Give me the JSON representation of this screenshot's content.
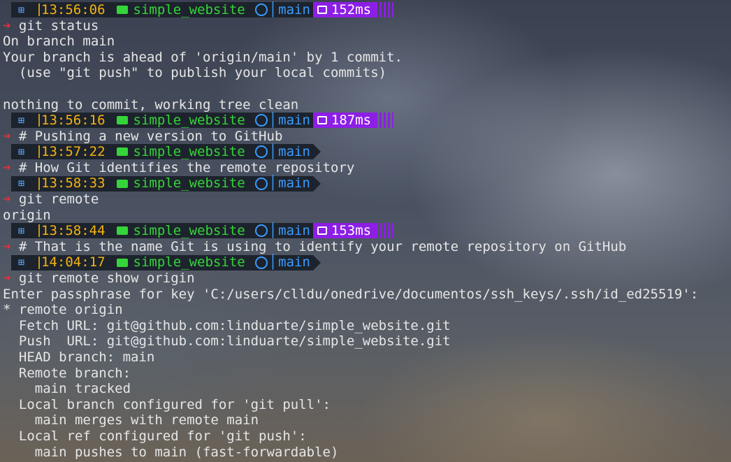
{
  "colors": {
    "prompt_bg": "#1d232c",
    "time": "#f5b313",
    "dir": "#35d43a",
    "git": "#3b9bff",
    "duration_bg": "#8d1ee6",
    "arrow": "#e0303a",
    "text": "#e6e6e6"
  },
  "icons": {
    "os": "windows-icon",
    "dir": "folder-icon",
    "git": "github-icon",
    "branch": "branch-icon",
    "duration": "stopwatch-icon",
    "prompt_arrow": "➜"
  },
  "lines": [
    {
      "type": "prompt",
      "time": "13:56:06",
      "dir": "simple_website",
      "branch": "main",
      "duration": "152ms"
    },
    {
      "type": "cmd",
      "text": "git status"
    },
    {
      "type": "out",
      "text": "On branch main"
    },
    {
      "type": "out",
      "text": "Your branch is ahead of 'origin/main' by 1 commit."
    },
    {
      "type": "out",
      "text": "  (use \"git push\" to publish your local commits)"
    },
    {
      "type": "out",
      "text": ""
    },
    {
      "type": "out",
      "text": "nothing to commit, working tree clean"
    },
    {
      "type": "prompt",
      "time": "13:56:16",
      "dir": "simple_website",
      "branch": "main",
      "duration": "187ms"
    },
    {
      "type": "cmd",
      "text": "# Pushing a new version to GitHub"
    },
    {
      "type": "prompt",
      "time": "13:57:22",
      "dir": "simple_website",
      "branch": "main",
      "duration": ""
    },
    {
      "type": "cmd",
      "text": "# How Git identifies the remote repository"
    },
    {
      "type": "prompt",
      "time": "13:58:33",
      "dir": "simple_website",
      "branch": "main",
      "duration": ""
    },
    {
      "type": "cmd",
      "text": "git remote"
    },
    {
      "type": "out",
      "text": "origin"
    },
    {
      "type": "prompt",
      "time": "13:58:44",
      "dir": "simple_website",
      "branch": "main",
      "duration": "153ms"
    },
    {
      "type": "cmd",
      "text": "# That is the name Git is using to identify your remote repository on GitHub"
    },
    {
      "type": "prompt",
      "time": "14:04:17",
      "dir": "simple_website",
      "branch": "main",
      "duration": ""
    },
    {
      "type": "cmd",
      "text": "git remote show origin"
    },
    {
      "type": "out",
      "text": "Enter passphrase for key 'C:/users/clldu/onedrive/documentos/ssh_keys/.ssh/id_ed25519':"
    },
    {
      "type": "out",
      "text": "* remote origin"
    },
    {
      "type": "out",
      "text": "  Fetch URL: git@github.com:linduarte/simple_website.git"
    },
    {
      "type": "out",
      "text": "  Push  URL: git@github.com:linduarte/simple_website.git"
    },
    {
      "type": "out",
      "text": "  HEAD branch: main"
    },
    {
      "type": "out",
      "text": "  Remote branch:"
    },
    {
      "type": "out",
      "text": "    main tracked"
    },
    {
      "type": "out",
      "text": "  Local branch configured for 'git pull':"
    },
    {
      "type": "out",
      "text": "    main merges with remote main"
    },
    {
      "type": "out",
      "text": "  Local ref configured for 'git push':"
    },
    {
      "type": "out",
      "text": "    main pushes to main (fast-forwardable)"
    }
  ]
}
